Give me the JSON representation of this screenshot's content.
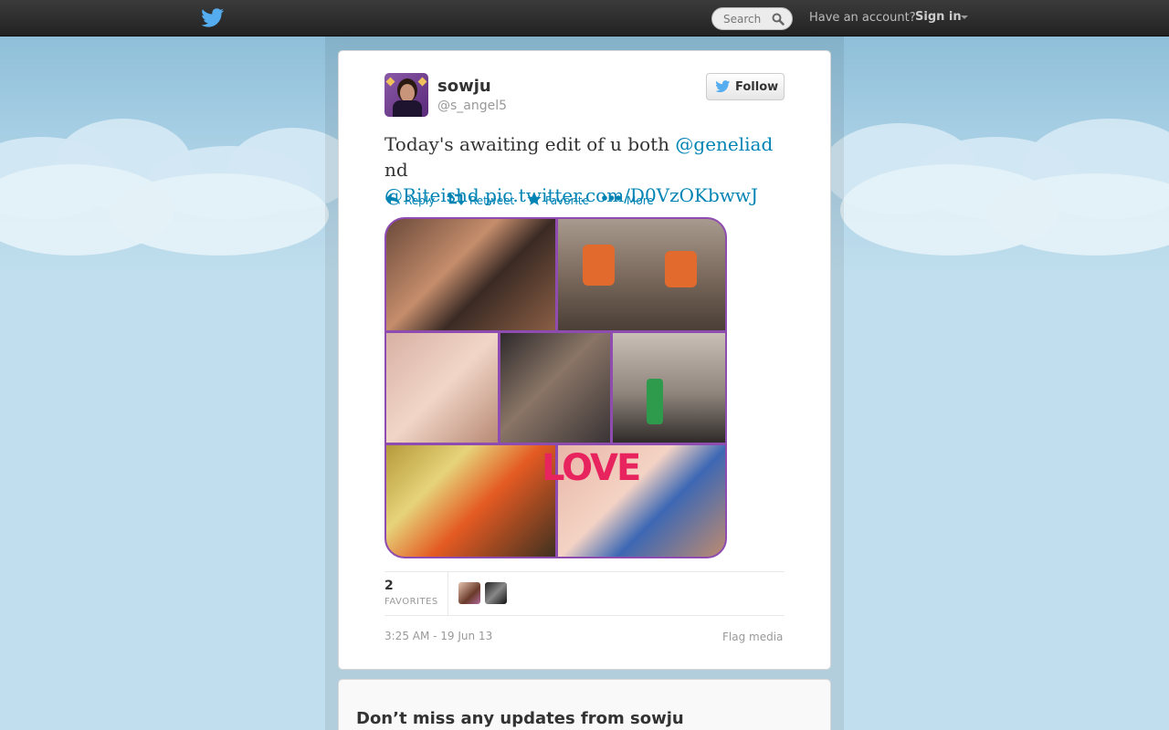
{
  "topbar": {
    "logo_icon": "twitter-bird-icon",
    "search": {
      "placeholder": "Search",
      "icon": "search-icon"
    },
    "have_account": "Have an account?",
    "sign_in": "Sign in"
  },
  "tweet": {
    "user": {
      "full_name": "sowju",
      "screen_name": "@s_angel5"
    },
    "follow_label": "Follow",
    "text": {
      "part1": "Today's awaiting edit of u both ",
      "mention1": "@geneliad",
      "part2": " nd",
      "mention2": "@Riteishd",
      "link": "pic.twitter.com/D0VzOKbwwJ"
    },
    "actions": {
      "reply": "Reply",
      "retweet": "Retweet",
      "favorite": "Favorite",
      "more": "More"
    },
    "media_overlay_text": "LOVE",
    "stats": {
      "favorites_count": "2",
      "favorites_label": "FAVORITES"
    },
    "timestamp": "3:25 AM - 19 Jun 13",
    "flag_media": "Flag media"
  },
  "promo": {
    "heading": "Don’t miss any updates from sowju"
  },
  "colors": {
    "link": "#0084b4",
    "topbar": "#2b2b2b",
    "sky": "#c0deed",
    "media_border": "#8e4bb0",
    "love": "#e8245e"
  }
}
